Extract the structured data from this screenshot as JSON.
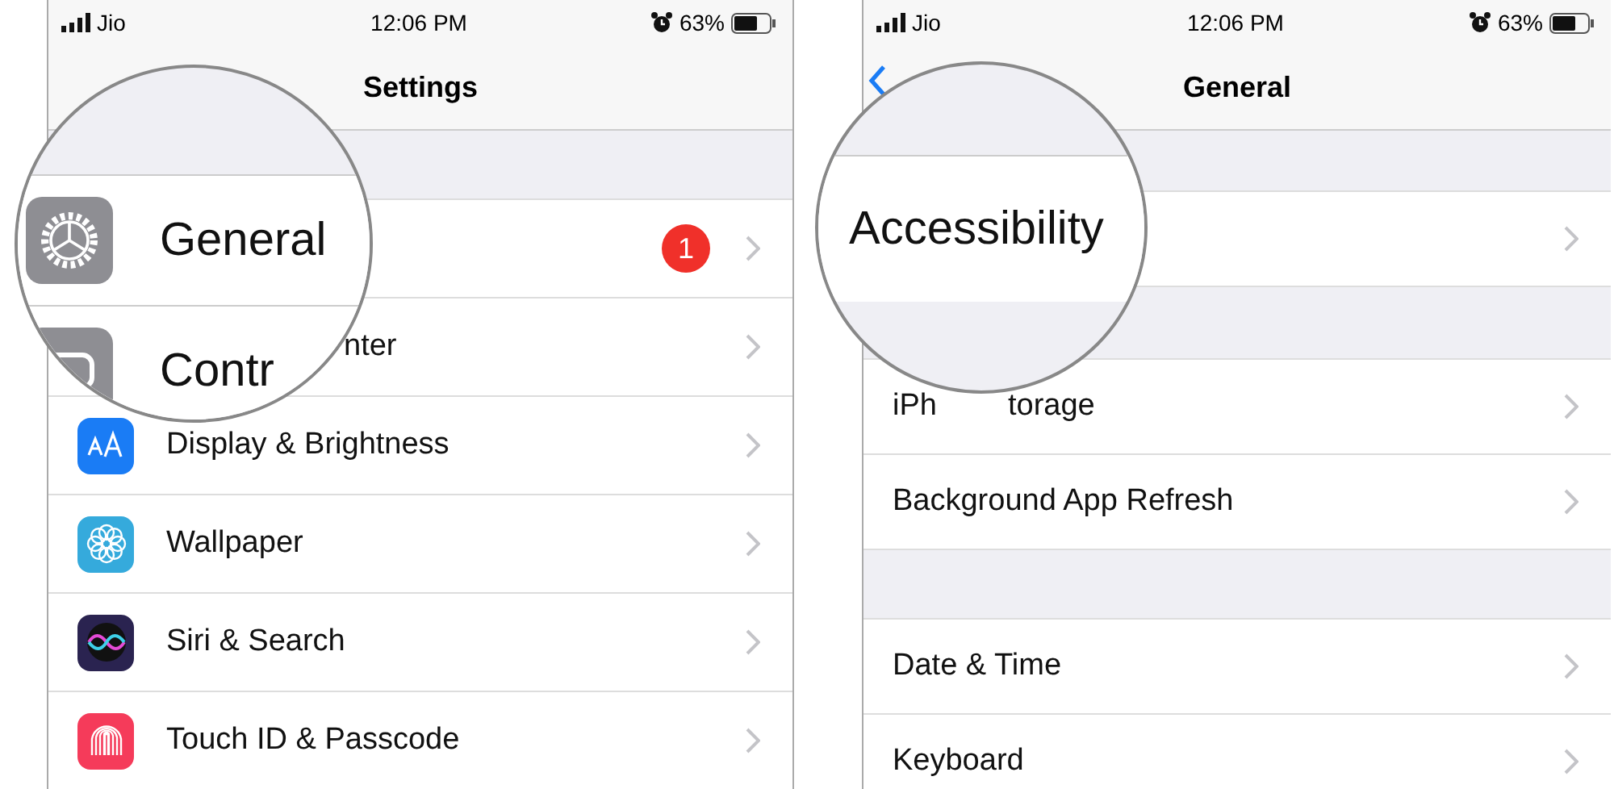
{
  "panels": [
    {
      "status_bar": {
        "carrier": "Jio",
        "time": "12:06 PM",
        "battery": "63%"
      },
      "nav": {
        "title": "Settings",
        "back": false
      },
      "sections": [
        {
          "rows": [
            {
              "fragments": [],
              "badge": "1"
            },
            {
              "fragments": [
                "nter"
              ],
              "lead_gap": true
            },
            {
              "color": "#1a7cf5",
              "fragments": [
                "Display & Brightness"
              ]
            },
            {
              "color": "#35aadc",
              "fragments": [
                "Wallpaper"
              ]
            },
            {
              "color": "#2a2350",
              "fragments": [
                "Siri & Search"
              ]
            },
            {
              "color": "#f53b5a",
              "fragments": [
                "Touch ID & Passcode"
              ]
            }
          ]
        }
      ],
      "magnifier": {
        "rows": [
          {
            "label": "General",
            "color": "#8e8e93"
          },
          {
            "label": "Contr",
            "color": "#8e8e93"
          }
        ]
      }
    },
    {
      "status_bar": {
        "carrier": "Jio",
        "time": "12:06 PM",
        "battery": "63%"
      },
      "nav": {
        "title": "General",
        "back": true
      },
      "sections": [
        {
          "rows": [
            {
              "fragments": []
            }
          ]
        },
        {
          "rows": [
            {
              "fragments": [
                "iPh",
                "torage"
              ]
            },
            {
              "fragments": [
                "Background App Refresh"
              ]
            }
          ]
        },
        {
          "rows": [
            {
              "fragments": [
                "Date & Time"
              ]
            },
            {
              "fragments": [
                "Keyboard"
              ]
            }
          ]
        }
      ],
      "magnifier": {
        "rows": [
          {
            "label": "Accessibility"
          }
        ]
      }
    }
  ]
}
